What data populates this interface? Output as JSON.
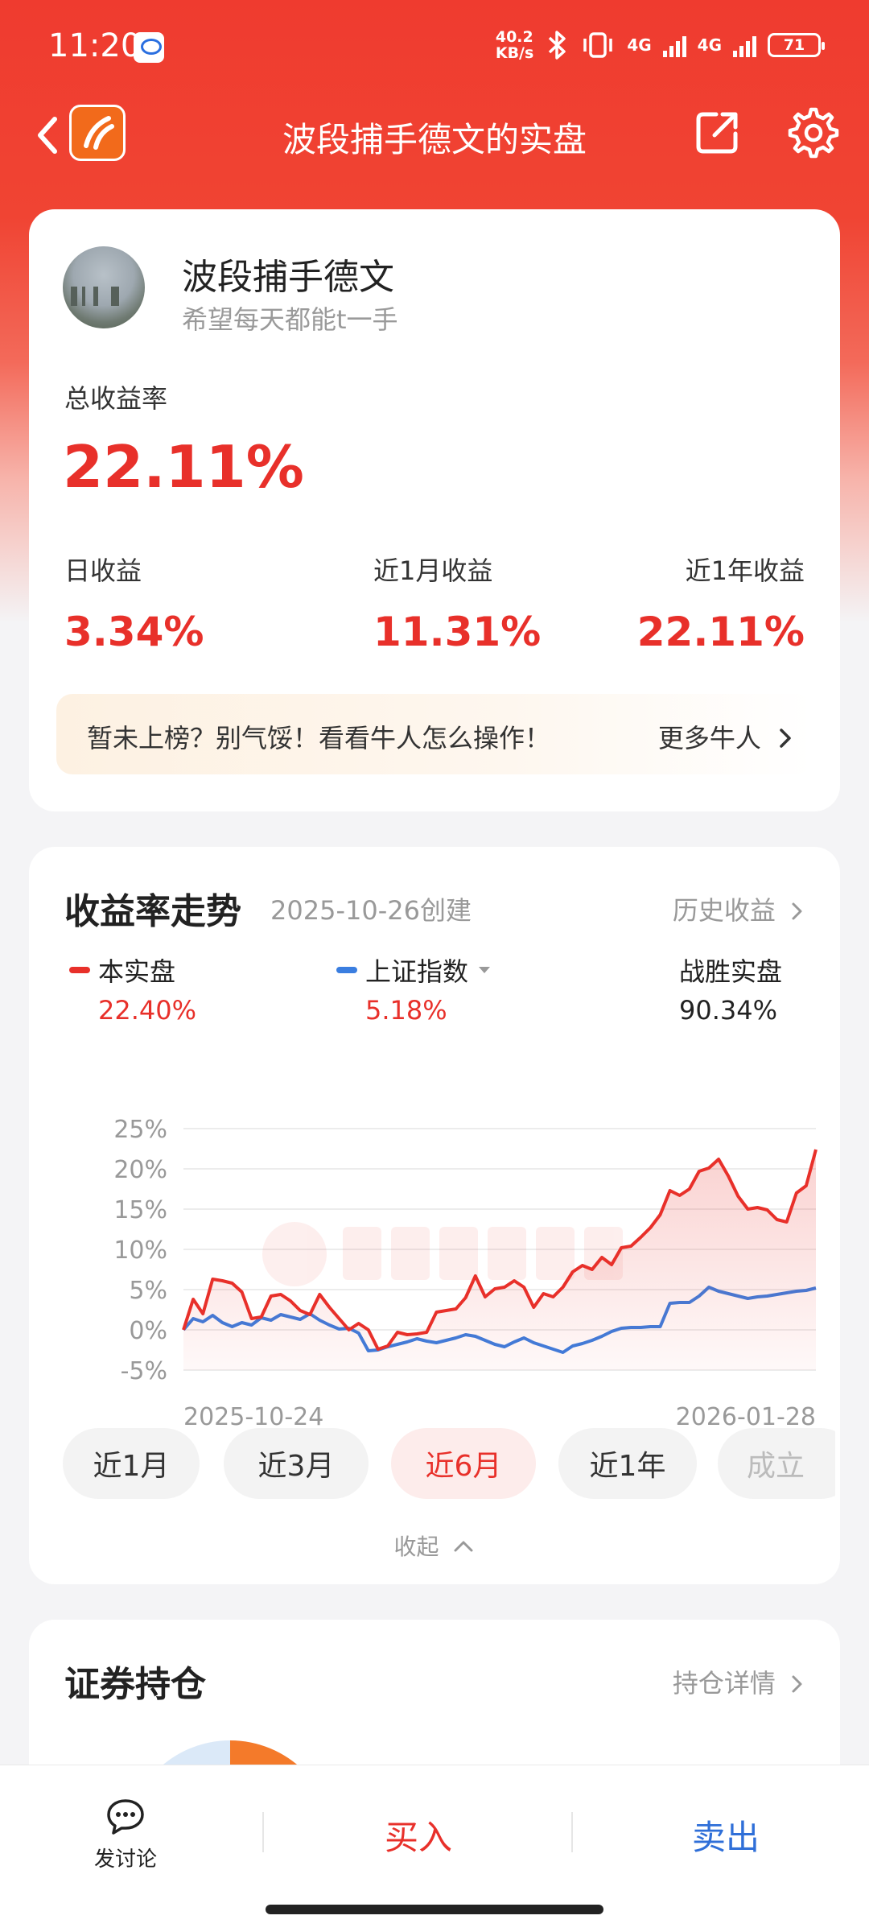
{
  "status_bar": {
    "time": "11:20",
    "speed_value": "40.2",
    "speed_unit": "KB/s",
    "net1": "4G",
    "net2": "4G",
    "battery": "71"
  },
  "nav": {
    "title": "波段捕手德文的实盘",
    "back_icon": "chevron-left-icon",
    "share_icon": "share-icon",
    "settings_icon": "gear-icon"
  },
  "profile": {
    "name": "波段捕手德文",
    "bio": "希望每天都能t一手",
    "total_label": "总收益率",
    "total_value": "22.11%",
    "stats": [
      {
        "label": "日收益",
        "value": "3.34%"
      },
      {
        "label": "近1月收益",
        "value": "11.31%"
      },
      {
        "label": "近1年收益",
        "value": "22.11%"
      }
    ],
    "banner_text": "暂未上榜？别气馁！看看牛人怎么操作！",
    "banner_more": "更多牛人"
  },
  "trend": {
    "title": "收益率走势",
    "created": "2025-10-26创建",
    "history_link": "历史收益",
    "legend": [
      {
        "name": "本实盘",
        "value": "22.40%",
        "color": "#e8302a"
      },
      {
        "name": "上证指数",
        "value": "5.18%",
        "color": "#3a7ee0"
      },
      {
        "name": "战胜实盘",
        "value": "90.34%"
      }
    ],
    "ranges": [
      "近1月",
      "近3月",
      "近6月",
      "近1年",
      "成立"
    ],
    "active_range": "近6月",
    "collapse_label": "收起"
  },
  "holdings": {
    "title": "证券持仓",
    "detail_link": "持仓详情"
  },
  "bottom": {
    "discuss": "发讨论",
    "buy": "买入",
    "sell": "卖出"
  },
  "colors": {
    "brand_red": "#e8302a",
    "index_blue": "#3a7ee0",
    "sell_blue": "#2f6fd8"
  },
  "chart_data": {
    "type": "line",
    "x_start": "2025-10-24",
    "x_end": "2026-01-28",
    "xtick_labels": [
      "2025-10-24",
      "2026-01-28"
    ],
    "ytick_labels": [
      "25%",
      "20%",
      "15%",
      "10%",
      "5%",
      "0%",
      "-5%"
    ],
    "ylim": [
      -5,
      25
    ],
    "grid": true,
    "series": [
      {
        "name": "本实盘",
        "color": "#e8302a",
        "values": [
          0.0,
          3.8,
          2.0,
          6.3,
          6.1,
          5.8,
          4.7,
          1.4,
          1.6,
          4.2,
          4.4,
          3.6,
          2.4,
          1.9,
          4.4,
          2.8,
          1.4,
          0.0,
          0.8,
          0.0,
          -2.4,
          -2.0,
          -0.3,
          -0.6,
          -0.5,
          -0.3,
          2.2,
          2.4,
          2.6,
          4.0,
          6.7,
          4.1,
          5.1,
          5.3,
          6.1,
          5.3,
          2.8,
          4.5,
          4.1,
          5.3,
          7.2,
          8.0,
          7.5,
          9.0,
          8.1,
          10.2,
          10.4,
          11.5,
          12.7,
          14.3,
          17.3,
          16.7,
          17.5,
          19.7,
          20.1,
          21.2,
          19.1,
          16.6,
          15.0,
          15.2,
          14.9,
          13.7,
          13.4,
          17.0,
          17.9,
          22.4
        ]
      },
      {
        "name": "上证指数",
        "color": "#3a7ee0",
        "values": [
          0.0,
          1.4,
          1.0,
          1.8,
          0.9,
          0.4,
          0.9,
          0.6,
          1.5,
          1.2,
          1.9,
          1.6,
          1.3,
          2.0,
          1.2,
          0.6,
          0.1,
          0.2,
          -0.4,
          -2.6,
          -2.5,
          -2.1,
          -1.8,
          -1.5,
          -1.1,
          -1.4,
          -1.6,
          -1.3,
          -1.0,
          -0.6,
          -0.8,
          -1.3,
          -1.8,
          -2.1,
          -1.5,
          -1.0,
          -1.6,
          -2.0,
          -2.4,
          -2.8,
          -2.0,
          -1.7,
          -1.3,
          -0.8,
          -0.2,
          0.2,
          0.3,
          0.3,
          0.4,
          0.4,
          3.3,
          3.4,
          3.4,
          4.2,
          5.3,
          4.8,
          4.5,
          4.2,
          3.9,
          4.1,
          4.2,
          4.4,
          4.6,
          4.8,
          4.9,
          5.2
        ]
      }
    ]
  }
}
